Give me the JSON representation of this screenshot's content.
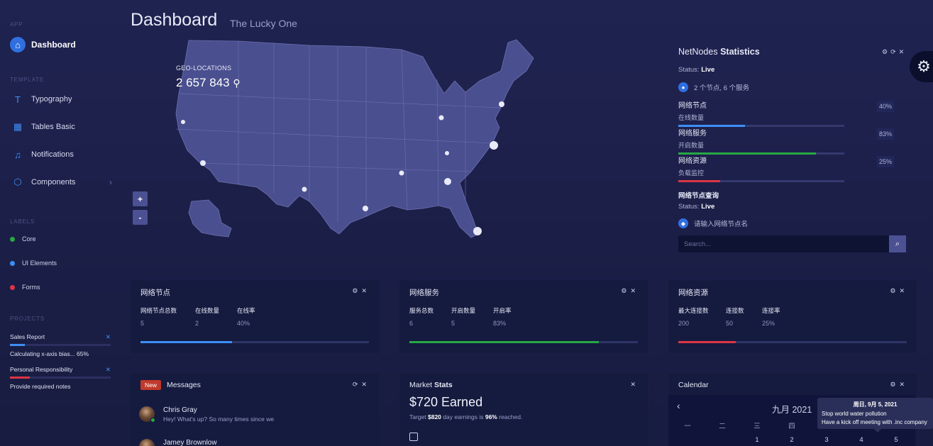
{
  "sidebar": {
    "sections": {
      "app": "APP",
      "template": "TEMPLATE",
      "labels": "LABELS",
      "projects": "PROJECTS"
    },
    "nav": [
      {
        "label": "Dashboard",
        "icon": "home-icon"
      },
      {
        "label": "Typography",
        "icon": "text-icon"
      },
      {
        "label": "Tables Basic",
        "icon": "table-icon"
      },
      {
        "label": "Notifications",
        "icon": "bell-icon"
      },
      {
        "label": "Components",
        "icon": "cube-icon"
      }
    ],
    "labels": [
      {
        "label": "Core",
        "color": "#28a745"
      },
      {
        "label": "UI Elements",
        "color": "#3e8ef7"
      },
      {
        "label": "Forms",
        "color": "#dc3545"
      }
    ],
    "projects": [
      {
        "name": "Sales Report",
        "detail": "Calculating x-axis bias... 65%",
        "progress": 0.15,
        "color": "#3e8ef7"
      },
      {
        "name": "Personal Responsibility",
        "detail": "Provide required notes",
        "progress": 0.2,
        "color": "#dc3545"
      }
    ]
  },
  "header": {
    "title": "Dashboard",
    "subtitle": "The Lucky One"
  },
  "map": {
    "geo_label": "GEO-LOCATIONS",
    "geo_value": "2 657 843",
    "zoom_in": "+",
    "zoom_out": "-"
  },
  "netnodes": {
    "title_prefix": "NetNodes",
    "title_bold": "Statistics",
    "status_label": "Status:",
    "status_value": "Live",
    "summary": "2 个节点, 6 个服务",
    "stats": [
      {
        "title": "网络节点",
        "sub": "在线数量",
        "pct": "40%",
        "value": 0.4,
        "color": "#3e8ef7"
      },
      {
        "title": "网络服务",
        "sub": "开启数量",
        "pct": "83%",
        "value": 0.83,
        "color": "#28a745"
      },
      {
        "title": "网络资源",
        "sub": "负载监控",
        "pct": "25%",
        "value": 0.25,
        "color": "#dc3545"
      }
    ],
    "query_title": "网络节点查询",
    "query_status_label": "Status:",
    "query_status_value": "Live",
    "query_hint": "请输入网络节点名",
    "search_placeholder": "Search..."
  },
  "cards": {
    "nodes": {
      "title": "网络节点",
      "cols": [
        {
          "k": "网络节点总数",
          "v": "5"
        },
        {
          "k": "在线数量",
          "v": "2"
        },
        {
          "k": "在线率",
          "v": "40%"
        }
      ],
      "progress": 0.4,
      "color": "#3e8ef7"
    },
    "services": {
      "title": "网络服务",
      "cols": [
        {
          "k": "服务总数",
          "v": "6"
        },
        {
          "k": "开启数量",
          "v": "5"
        },
        {
          "k": "开启率",
          "v": "83%"
        }
      ],
      "progress": 0.83,
      "color": "#28a745"
    },
    "resources": {
      "title": "网络资源",
      "cols": [
        {
          "k": "最大连接数",
          "v": "200"
        },
        {
          "k": "连接数",
          "v": "50"
        },
        {
          "k": "连接率",
          "v": "25%"
        }
      ],
      "progress": 0.25,
      "color": "#dc3545"
    }
  },
  "messages": {
    "badge": "New",
    "title": "Messages",
    "items": [
      {
        "name": "Chris Gray",
        "text": "Hey! What's up? So many times since we"
      },
      {
        "name": "Jamey Brownlow",
        "text": ""
      }
    ]
  },
  "market": {
    "title_prefix": "Market",
    "title_bold": "Stats",
    "earned": "$720 Earned",
    "target_pre": "Target",
    "target_amount": "$820",
    "target_mid": "day earnings is",
    "target_pct": "96%",
    "target_post": "reached."
  },
  "calendar": {
    "title": "Calendar",
    "month": "九月 2021",
    "weekdays": [
      "一",
      "二",
      "三",
      "四",
      "五",
      "六",
      "日"
    ],
    "days": [
      "1",
      "2",
      "3",
      "4",
      "5"
    ],
    "tooltip": {
      "date": "周日, 9月 5, 2021",
      "line1": "Stop world water pollution",
      "line2": "Have a kick off meeting with .inc company"
    }
  }
}
